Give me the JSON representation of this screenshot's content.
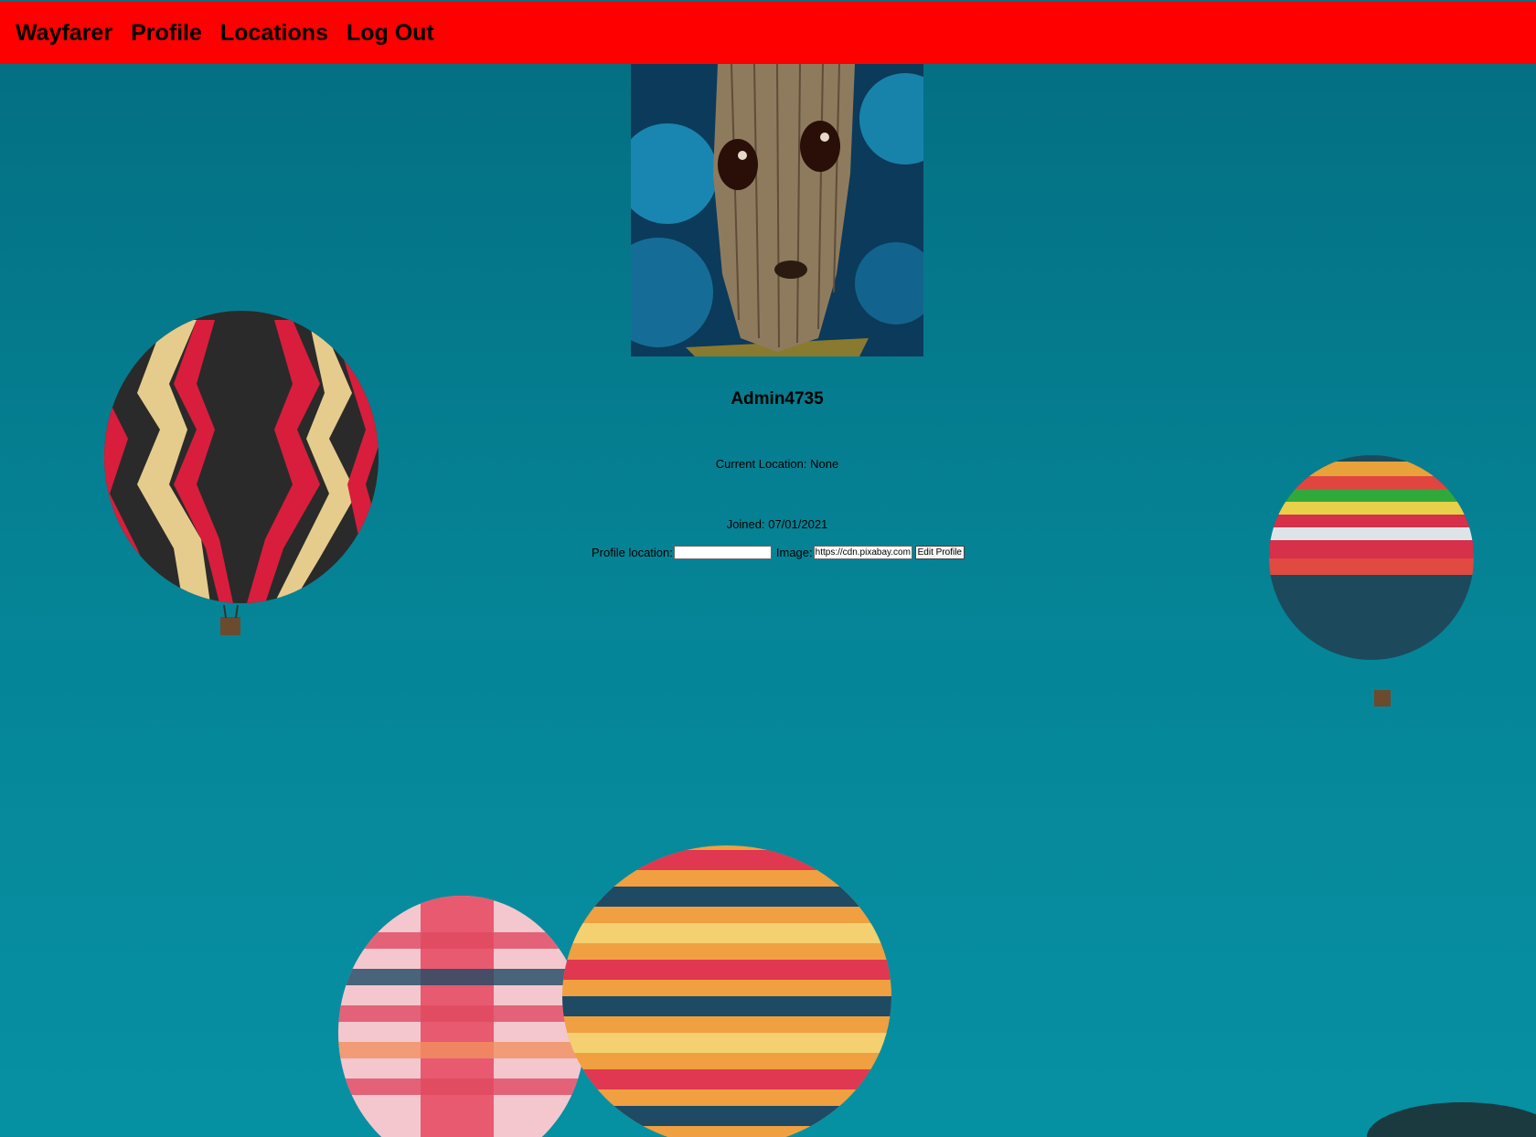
{
  "nav": {
    "items": [
      {
        "label": "Wayfarer"
      },
      {
        "label": "Profile"
      },
      {
        "label": "Locations"
      },
      {
        "label": "Log Out"
      }
    ]
  },
  "profile": {
    "username": "Admin4735",
    "current_location": "Current Location: None",
    "joined": "Joined: 07/01/2021"
  },
  "form": {
    "location_label": "Profile location:",
    "location_value": "",
    "image_label": "Image:",
    "image_value": "https://cdn.pixabay.com",
    "submit_label": "Edit Profile"
  },
  "colors": {
    "nav_background": "#ff0000",
    "page_background": "#058597"
  }
}
